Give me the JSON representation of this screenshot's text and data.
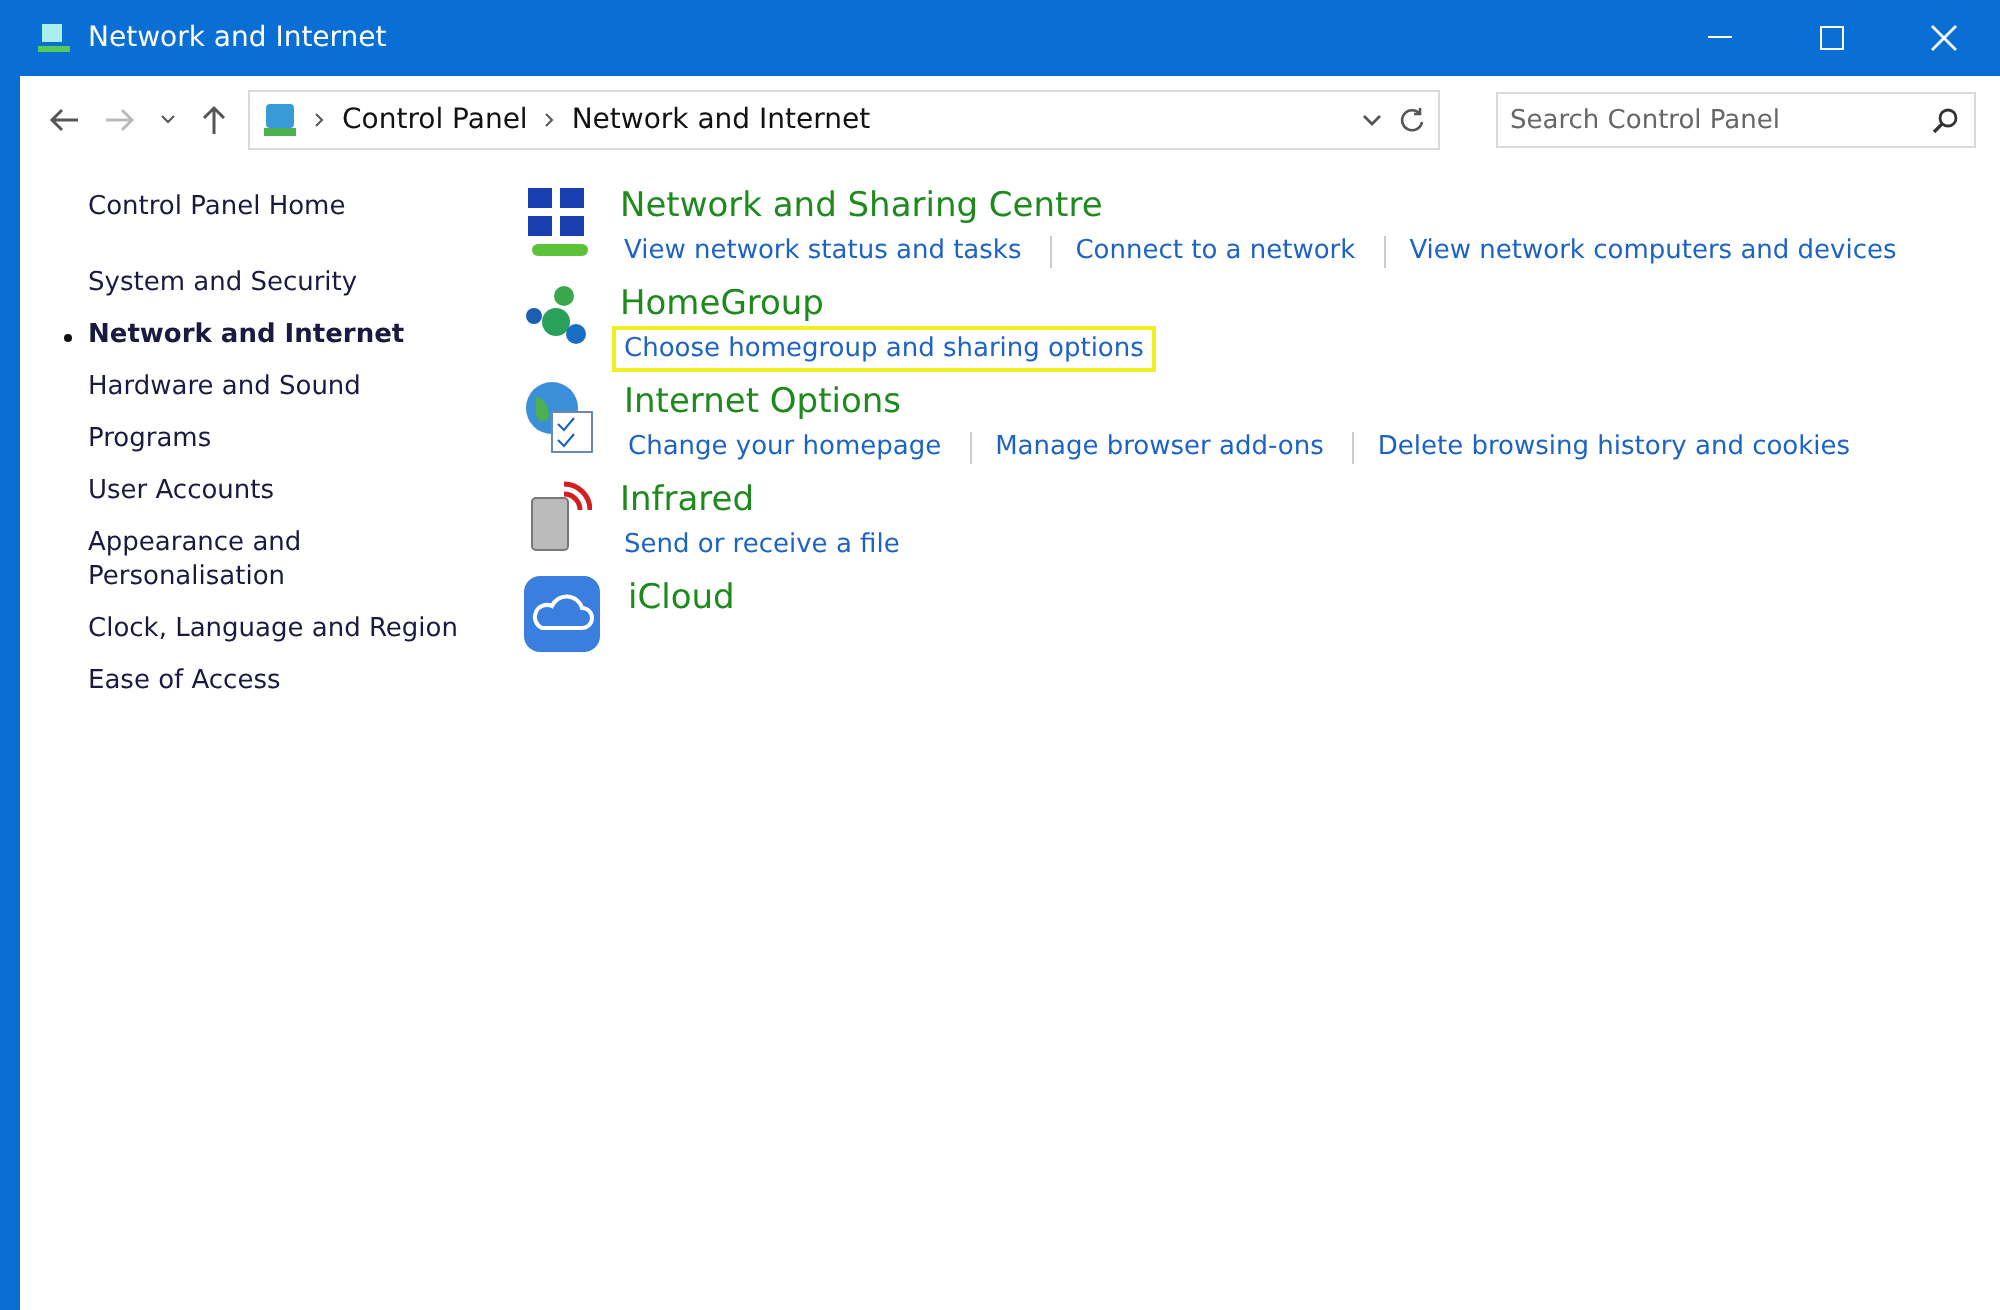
{
  "window": {
    "title": "Network and Internet"
  },
  "address_bar": {
    "breadcrumbs": [
      "Control Panel",
      "Network and Internet"
    ]
  },
  "search": {
    "placeholder": "Search Control Panel"
  },
  "sidebar": {
    "home": "Control Panel Home",
    "items": [
      {
        "label": "System and Security",
        "selected": false
      },
      {
        "label": "Network and Internet",
        "selected": true
      },
      {
        "label": "Hardware and Sound",
        "selected": false
      },
      {
        "label": "Programs",
        "selected": false
      },
      {
        "label": "User Accounts",
        "selected": false
      },
      {
        "label": "Appearance and Personalisation",
        "selected": false
      },
      {
        "label": "Clock, Language and Region",
        "selected": false
      },
      {
        "label": "Ease of Access",
        "selected": false
      }
    ]
  },
  "categories": [
    {
      "kind": "network",
      "title": "Network and Sharing Centre",
      "links": [
        {
          "label": "View network status and tasks",
          "highlighted": false
        },
        {
          "label": "Connect to a network",
          "highlighted": false
        },
        {
          "label": "View network computers and devices",
          "highlighted": false
        }
      ]
    },
    {
      "kind": "homegroup",
      "title": "HomeGroup",
      "links": [
        {
          "label": "Choose homegroup and sharing options",
          "highlighted": true
        }
      ]
    },
    {
      "kind": "internet",
      "title": "Internet Options",
      "links": [
        {
          "label": "Change your homepage",
          "highlighted": false
        },
        {
          "label": "Manage browser add-ons",
          "highlighted": false
        },
        {
          "label": "Delete browsing history and cookies",
          "highlighted": false
        }
      ]
    },
    {
      "kind": "infrared",
      "title": "Infrared",
      "links": [
        {
          "label": "Send or receive a file",
          "highlighted": false
        }
      ]
    },
    {
      "kind": "cloud",
      "title": "iCloud"
    }
  ]
}
